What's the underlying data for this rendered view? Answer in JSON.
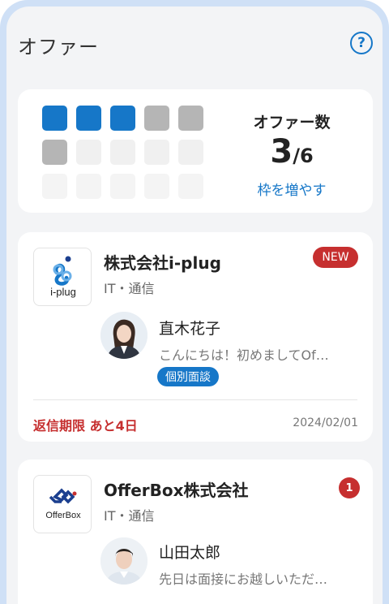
{
  "header": {
    "title": "オファー",
    "help_icon": "question-circle-icon"
  },
  "offer_count": {
    "label": "オファー数",
    "current": "3",
    "total": "/6",
    "increase_link": "枠を増やす",
    "filled_slots": 3,
    "max_slots": 6
  },
  "offers": [
    {
      "company": "株式会社i-plug",
      "industry": "IT・通信",
      "logo_text": "i-plug",
      "badge": "NEW",
      "recruiter": "直木花子",
      "message": "こんにちは！初めましてOf…",
      "tag": "個別面談",
      "deadline": "返信期限 あと4日",
      "date": "2024/02/01"
    },
    {
      "company": "OfferBox株式会社",
      "industry": "IT・通信",
      "logo_text": "OfferBox",
      "badge": "1",
      "recruiter": "山田太郎",
      "message": "先日は面接にお越しいただ…"
    }
  ],
  "colors": {
    "accent": "#1677c8",
    "alert": "#c62f2f",
    "frame": "#cfe0f6"
  }
}
